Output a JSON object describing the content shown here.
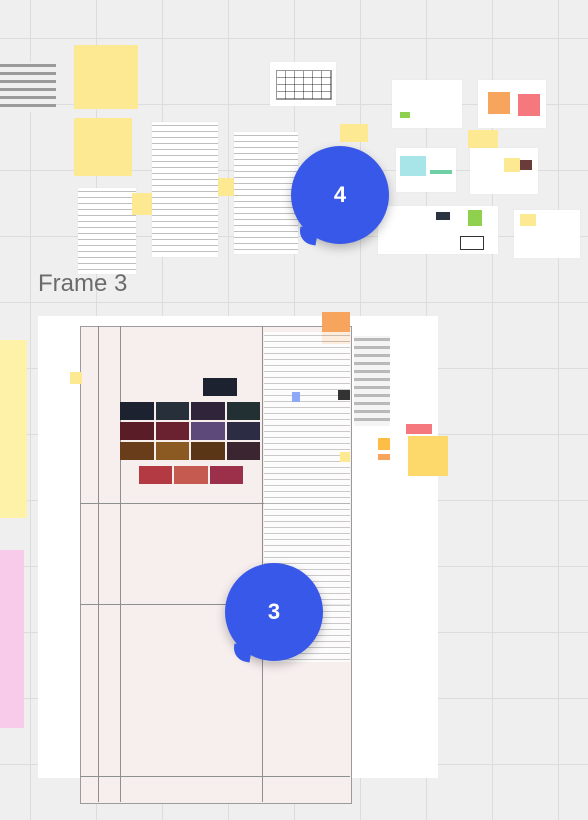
{
  "board": {
    "frame_label": "Frame 3",
    "comment_bubbles": [
      {
        "count": "4"
      },
      {
        "count": "3"
      }
    ]
  },
  "colors": {
    "bubble": "#3858e9",
    "sticky_yellow": "#fde992",
    "sticky_pink": "#f9cbeb",
    "sticky_orange": "#f7a45c",
    "canvas": "#efefef"
  }
}
